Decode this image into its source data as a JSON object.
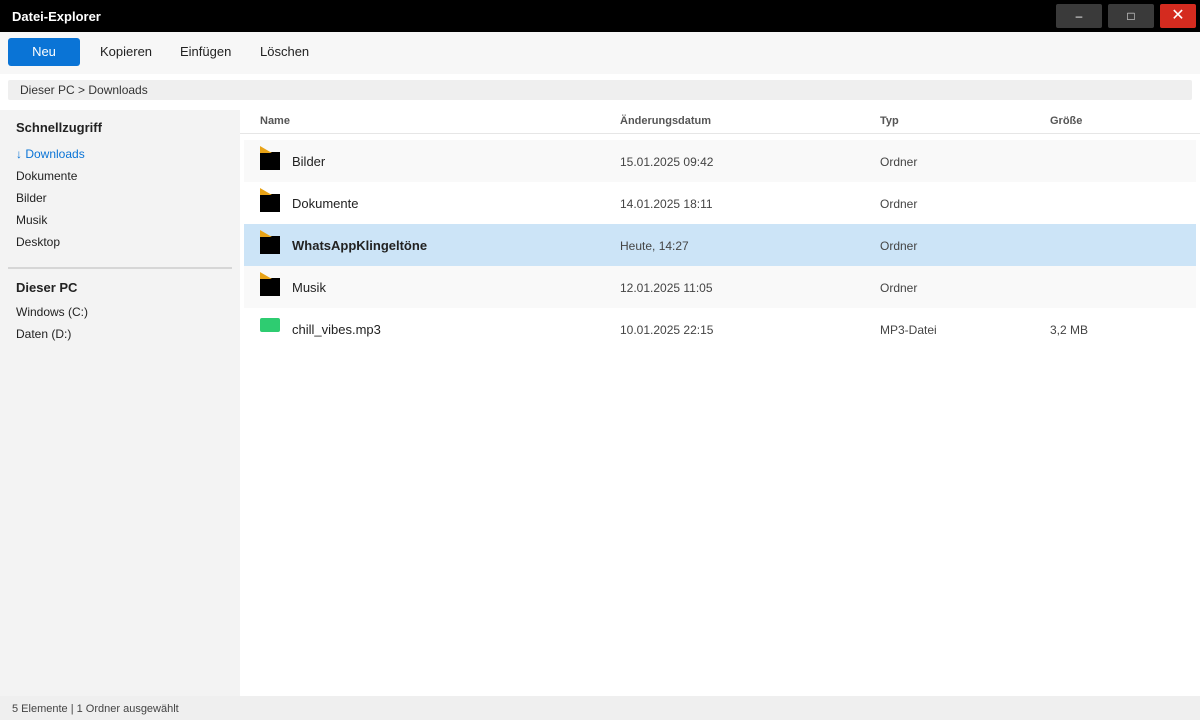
{
  "window": {
    "title": "Datei-Explorer",
    "minimize_label": "–",
    "maximize_label": "□",
    "close_label": "✕"
  },
  "toolbar": {
    "new_label": "Neu",
    "copy_label": "Kopieren",
    "paste_label": "Einfügen",
    "delete_label": "Löschen"
  },
  "breadcrumb": "Dieser PC > Downloads",
  "sidebar": {
    "quick_access_heading": "Schnellzugriff",
    "quick_access_items": [
      {
        "label": "↓ Downloads",
        "active": true
      },
      {
        "label": "Dokumente"
      },
      {
        "label": "Bilder"
      },
      {
        "label": "Musik"
      },
      {
        "label": "Desktop"
      }
    ],
    "this_pc_heading": "Dieser PC",
    "drives": [
      {
        "label": "Windows (C:)"
      },
      {
        "label": "Daten (D:)"
      }
    ]
  },
  "columns": {
    "name": "Name",
    "date": "Änderungsdatum",
    "type": "Typ",
    "size": "Größe"
  },
  "files": [
    {
      "name": "Bilder",
      "date": "15.01.2025 09:42",
      "type": "Ordner",
      "size": "",
      "icon": "folder-icon"
    },
    {
      "name": "Dokumente",
      "date": "14.01.2025 18:11",
      "type": "Ordner",
      "size": "",
      "icon": "folder-icon"
    },
    {
      "name": "WhatsAppKlingeltöne",
      "date": "Heute, 14:27",
      "type": "Ordner",
      "size": "",
      "icon": "folder-icon",
      "selected": true
    },
    {
      "name": "Musik",
      "date": "12.01.2025 11:05",
      "type": "Ordner",
      "size": "",
      "icon": "folder-icon"
    },
    {
      "name": "chill_vibes.mp3",
      "date": "10.01.2025 22:15",
      "type": "MP3-Datei",
      "size": "3,2 MB",
      "icon": "audio-file-icon"
    }
  ],
  "status": "5 Elemente | 1 Ordner ausgewählt",
  "colors": {
    "accent": "#0a74d6",
    "selection": "#cce4f7",
    "close": "#d42b1f",
    "folder_tab": "#e8a317",
    "audio_file": "#2ecc71"
  }
}
